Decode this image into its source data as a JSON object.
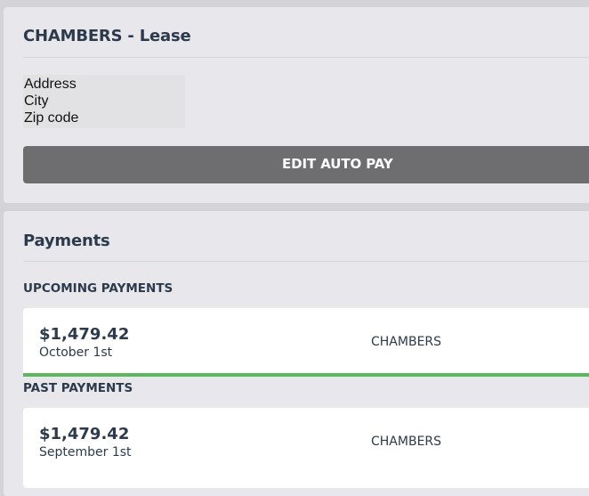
{
  "lease": {
    "title": "CHAMBERS - Lease",
    "address_lines": [
      "Address",
      "City",
      "Zip code"
    ],
    "edit_auto_pay_label": "EDIT AUTO PAY"
  },
  "payments": {
    "title": "Payments",
    "upcoming": {
      "label": "UPCOMING PAYMENTS",
      "items": [
        {
          "amount": "$1,479.42",
          "date": "October 1st",
          "payee": "CHAMBERS",
          "status_color": "#5cb85c"
        }
      ]
    },
    "past": {
      "label": "PAST PAYMENTS",
      "items": [
        {
          "amount": "$1,479.42",
          "date": "September 1st",
          "payee": "CHAMBERS"
        }
      ]
    }
  }
}
